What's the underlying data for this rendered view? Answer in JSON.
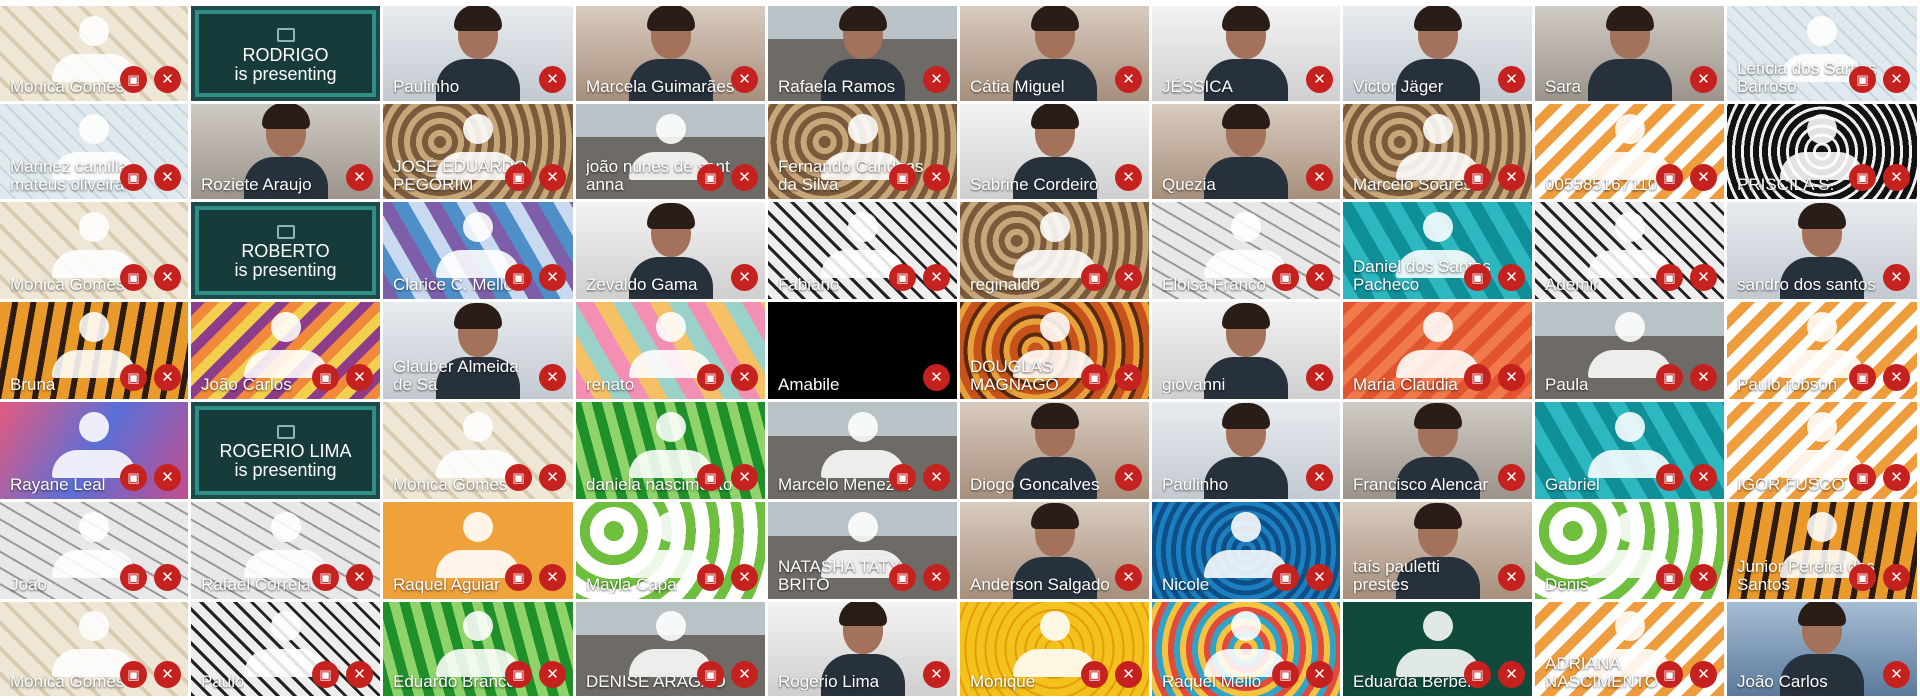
{
  "icons": {
    "mic_off": "mic-off-icon",
    "camera_off": "camera-off-icon",
    "presenting": "present-screen-icon"
  },
  "colors": {
    "muted_badge": "#c5221f",
    "presenting_tile": "#1d4b4b",
    "presenting_border": "#2f8f86"
  },
  "rows": [
    [
      {
        "name": "Monica Gomes",
        "video": "avatar",
        "bg": "beige",
        "cam_off": true
      },
      {
        "name": "RODRIGO\nis presenting",
        "video": "presenting"
      },
      {
        "name": "Paulinho",
        "video": "person",
        "bg": "office"
      },
      {
        "name": "Marcela Guimarães",
        "video": "person",
        "bg": "room"
      },
      {
        "name": "Rafaela Ramos",
        "video": "person",
        "bg": "city"
      },
      {
        "name": "Cátia Miguel",
        "video": "person",
        "bg": "room"
      },
      {
        "name": "JÉSSICA",
        "video": "person",
        "bg": "light"
      },
      {
        "name": "Victor Jäger",
        "video": "person",
        "bg": "office"
      },
      {
        "name": "Sara",
        "video": "person",
        "bg": "wall"
      },
      {
        "name": "Letícia dos Santos\nBarroso",
        "video": "avatar",
        "bg": "lightblue",
        "cam_off": true
      }
    ],
    [
      {
        "name": "Marinez camilla\nmateus oliveira",
        "video": "avatar",
        "bg": "lightblue",
        "cam_off": true
      },
      {
        "name": "Roziete Araujo",
        "video": "person",
        "bg": "wall"
      },
      {
        "name": "JOSÉ EDUARDO\nPEGORIM",
        "video": "avatar",
        "bg": "sepia",
        "cam_off": true
      },
      {
        "name": "joão nunes de sant\nanna",
        "video": "avatar",
        "bg": "city",
        "cam_off": true
      },
      {
        "name": "Fernando Candeas\nda Silva",
        "video": "avatar",
        "bg": "sepia",
        "cam_off": true
      },
      {
        "name": "Sabrine Cordeiro",
        "video": "person",
        "bg": "light"
      },
      {
        "name": "Quezia",
        "video": "person",
        "bg": "room"
      },
      {
        "name": "Marcelo Soares",
        "video": "avatar",
        "bg": "sepia",
        "cam_off": true
      },
      {
        "name": "005585167110",
        "video": "avatar",
        "bg": "orangezig",
        "cam_off": true
      },
      {
        "name": "PRISCILA S.",
        "video": "avatar",
        "bg": "swirl",
        "cam_off": true
      }
    ],
    [
      {
        "name": "Monica Gomes",
        "video": "avatar",
        "bg": "beige",
        "cam_off": true
      },
      {
        "name": "ROBERTO\nis presenting",
        "video": "presenting"
      },
      {
        "name": "Clarice C. Mello",
        "video": "avatar",
        "bg": "cubes",
        "cam_off": true
      },
      {
        "name": "Zevaldo Gama",
        "video": "person",
        "bg": "light"
      },
      {
        "name": "Fabiano",
        "video": "avatar",
        "bg": "lattice",
        "cam_off": true
      },
      {
        "name": "reginaldo",
        "video": "avatar",
        "bg": "sepia",
        "cam_off": true
      },
      {
        "name": "Eloisa Franco",
        "video": "avatar",
        "bg": "gray",
        "cam_off": true
      },
      {
        "name": "Daniel dos Santos\nPacheco",
        "video": "avatar",
        "bg": "teal",
        "cam_off": true
      },
      {
        "name": "Ademir",
        "video": "avatar",
        "bg": "lattice",
        "cam_off": true
      },
      {
        "name": "sandro dos santos",
        "video": "person",
        "bg": "office"
      }
    ],
    [
      {
        "name": "Bruna",
        "video": "avatar",
        "bg": "tiger",
        "cam_off": true
      },
      {
        "name": "João Carlos",
        "video": "avatar",
        "bg": "purplezig",
        "cam_off": true
      },
      {
        "name": "Glauber Almeida\nde Sá",
        "video": "person",
        "bg": "office"
      },
      {
        "name": "renato",
        "video": "avatar",
        "bg": "pinktri",
        "cam_off": true
      },
      {
        "name": "Amabile",
        "video": "none",
        "bg": "black"
      },
      {
        "name": "DOUGLAS\nMAGNAGO",
        "video": "avatar",
        "bg": "paisley",
        "cam_off": true
      },
      {
        "name": "giovanni",
        "video": "person",
        "bg": "light"
      },
      {
        "name": "Maria Claudia",
        "video": "avatar",
        "bg": "redbrick",
        "cam_off": true
      },
      {
        "name": "Paula",
        "video": "avatar",
        "bg": "city",
        "cam_off": true
      },
      {
        "name": "Paulo robson",
        "video": "avatar",
        "bg": "orangezig",
        "cam_off": true
      }
    ],
    [
      {
        "name": "Rayane Leal",
        "video": "avatar",
        "bg": "watercolor",
        "cam_off": true
      },
      {
        "name": "ROGERIO LIMA\nis presenting",
        "video": "presenting"
      },
      {
        "name": "Monica Gomes",
        "video": "avatar",
        "bg": "beige",
        "cam_off": true
      },
      {
        "name": "daniela nascimento",
        "video": "avatar",
        "bg": "green",
        "cam_off": true
      },
      {
        "name": "Marcelo Menezes",
        "video": "avatar",
        "bg": "city",
        "cam_off": true
      },
      {
        "name": "Diogo Goncalves",
        "video": "person",
        "bg": "room"
      },
      {
        "name": "Paulinho",
        "video": "person",
        "bg": "office"
      },
      {
        "name": "Francisco Alencar",
        "video": "person",
        "bg": "wall"
      },
      {
        "name": "Gabriel",
        "video": "avatar",
        "bg": "teal",
        "cam_off": true
      },
      {
        "name": "IGOR FUSCO",
        "video": "avatar",
        "bg": "orangezig",
        "cam_off": true
      }
    ],
    [
      {
        "name": "João",
        "video": "avatar",
        "bg": "gray",
        "cam_off": true
      },
      {
        "name": "Rafael Correia",
        "video": "avatar",
        "bg": "gray",
        "cam_off": true
      },
      {
        "name": "Raquel Aguiar",
        "video": "avatar",
        "bg": "orange",
        "cam_off": true
      },
      {
        "name": "Mayla Capa",
        "video": "avatar",
        "bg": "greenleaf",
        "cam_off": true
      },
      {
        "name": "NATASHA TATY\nBRITO",
        "video": "avatar",
        "bg": "city",
        "cam_off": true
      },
      {
        "name": "Anderson Salgado",
        "video": "person",
        "bg": "room"
      },
      {
        "name": "Nicole",
        "video": "avatar",
        "bg": "bluemosaic",
        "cam_off": true
      },
      {
        "name": "taís pauletti\nprestes",
        "video": "person",
        "bg": "room"
      },
      {
        "name": "Denis",
        "video": "avatar",
        "bg": "greenleaf",
        "cam_off": true
      },
      {
        "name": "Junior Pereira dos\nSantos",
        "video": "avatar",
        "bg": "tiger",
        "cam_off": true
      }
    ],
    [
      {
        "name": "Monica Gomes",
        "video": "avatar",
        "bg": "beige",
        "cam_off": true
      },
      {
        "name": "Paulo",
        "video": "avatar",
        "bg": "lattice",
        "cam_off": true
      },
      {
        "name": "Eduardo Branco",
        "video": "avatar",
        "bg": "green",
        "cam_off": true
      },
      {
        "name": "DENISE ARAGÃO",
        "video": "avatar",
        "bg": "city",
        "cam_off": true
      },
      {
        "name": "Rogerio Lima",
        "video": "person",
        "bg": "light"
      },
      {
        "name": "Monique",
        "video": "avatar",
        "bg": "yellow",
        "cam_off": true
      },
      {
        "name": "Raquel Mello",
        "video": "avatar",
        "bg": "floral",
        "cam_off": true
      },
      {
        "name": "Eduarda Berbel",
        "video": "avatar",
        "bg": "darkgreen",
        "cam_off": true
      },
      {
        "name": "ADRIANA NASCIMENTO",
        "video": "avatar",
        "bg": "orangezig",
        "cam_off": true
      },
      {
        "name": "João Carlos",
        "video": "person",
        "bg": "blueroom"
      }
    ]
  ]
}
